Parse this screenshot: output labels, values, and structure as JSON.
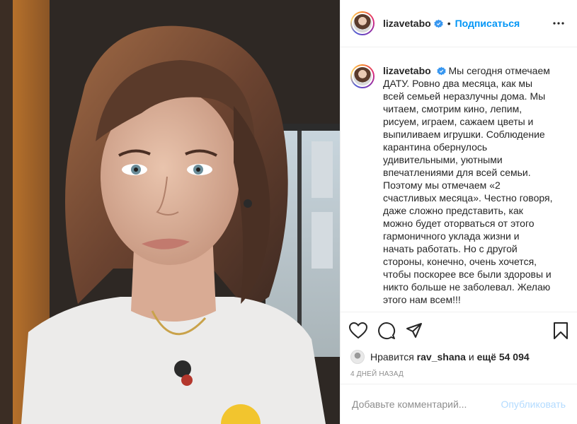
{
  "post": {
    "username": "lizavetabo",
    "follow_label": "Подписаться",
    "caption_lines": [
      "Мы сегодня отмечаем",
      "ДАТУ. Ровно два месяца, как мы",
      "всей семьей неразлучны дома. Мы",
      "читаем, смотрим кино, лепим,",
      "рисуем, играем, сажаем цветы и",
      "выпиливаем игрушки. Соблюдение",
      "карантина обернулось",
      "удивительными, уютными",
      "впечатлениями для всей семьи.",
      "Поэтому мы отмечаем «2",
      "счастливых месяца». Честно говоря,",
      "даже сложно представить, как",
      "можно будет оторваться от этого",
      "гармоничного уклада жизни и",
      "начать работать. Но с другой",
      "стороны, конечно, очень хочется,",
      "чтобы поскорее все были здоровы и",
      "никто больше не заболевал. Желаю",
      "этого нам всем!!!"
    ],
    "likes": {
      "prefix": "Нравится",
      "user": "rav_shana",
      "middle": "и",
      "others": "ещё 54 094"
    },
    "timestamp": "4 ДНЕЙ НАЗАД",
    "comment_placeholder": "Добавьте комментарий...",
    "publish_label": "Опубликовать"
  },
  "colors": {
    "accent": "#0095f6",
    "publish_disabled": "#b3dbff",
    "verified": "#3897f0",
    "text": "#262626",
    "muted": "#8e8e8e"
  },
  "icons": [
    "more-options-icon",
    "heart-icon",
    "comment-icon",
    "share-icon",
    "bookmark-icon",
    "verified-badge-icon"
  ]
}
